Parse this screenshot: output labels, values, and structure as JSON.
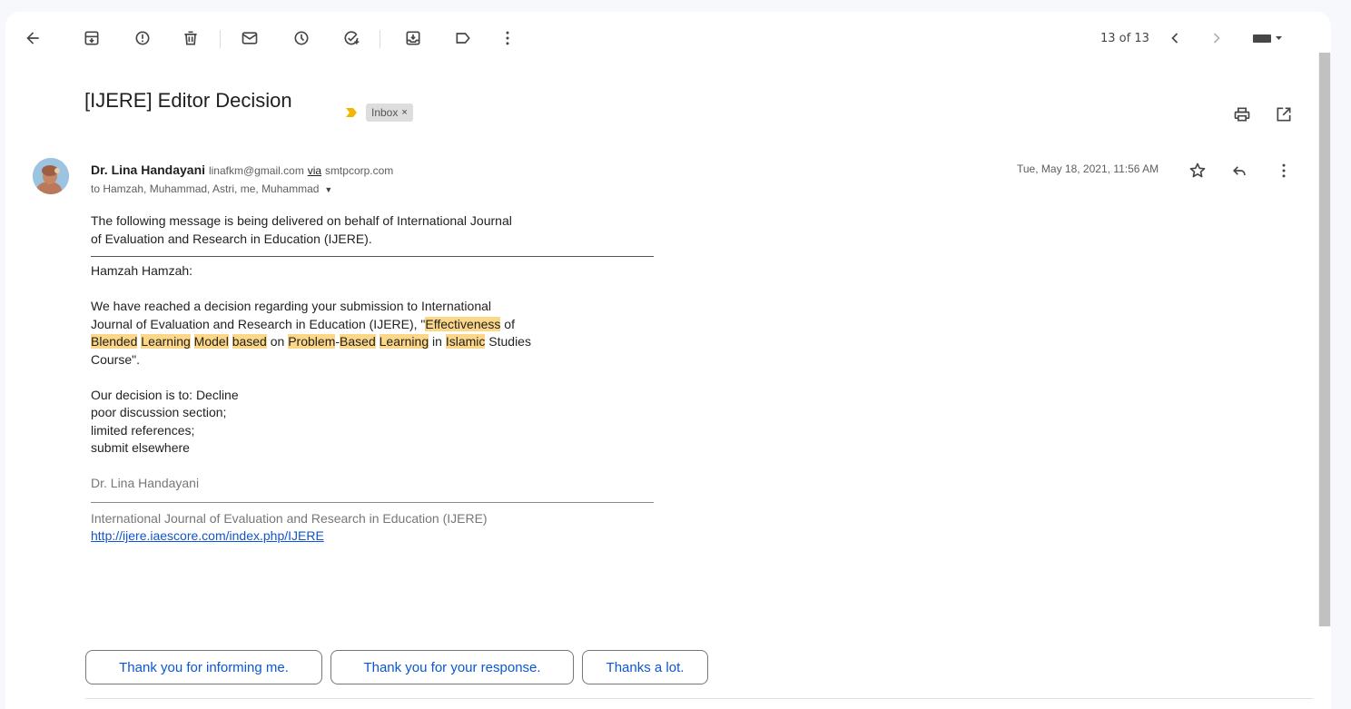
{
  "toolbar": {
    "icons": [
      "back-arrow-icon",
      "archive-icon",
      "report-spam-icon",
      "delete-icon",
      "mark-unread-icon",
      "snooze-icon",
      "add-to-tasks-icon",
      "move-to-icon",
      "label-icon",
      "more-vert-icon",
      "newer-icon",
      "older-icon",
      "input-tools-icon"
    ],
    "counter": "13 of 13"
  },
  "subject": {
    "title": "[IJERE] Editor Decision",
    "label": "Inbox",
    "label_remove": "×"
  },
  "message": {
    "sender_name": "Dr. Lina Handayani",
    "sender_email": "linafkm@gmail.com",
    "via_label": "via",
    "via_domain": "smtpcorp.com",
    "recipients": "to Hamzah, Muhammad, Astri, me, Muhammad",
    "date": "Tue, May 18, 2021, 11:56 AM"
  },
  "body": {
    "intro_1": "The following message is being delivered on behalf of International Journal",
    "intro_2": "of Evaluation and Research in Education (IJERE).",
    "greeting": "Hamzah Hamzah:",
    "p1_line1": "We have reached a decision regarding your submission to International",
    "p1_line2_pre": "Journal of Evaluation and Research in Education (IJERE), \"",
    "hl_effectiveness": "Effectiveness",
    "w_of": " of",
    "hl_blended": "Blended",
    "hl_learning1": "Learning",
    "hl_model": "Model",
    "hl_based": "based",
    "w_on": " on ",
    "hl_problem": "Problem",
    "w_dash": "-",
    "hl_based2": "Based",
    "hl_learning2": "Learning",
    "w_in": " in ",
    "hl_islamic": "Islamic",
    "w_studies": " Studies",
    "p1_end": "Course\".",
    "decision": "Our decision is to: Decline",
    "reason1": "poor discussion section;",
    "reason2": "limited references;",
    "reason3": "submit elsewhere",
    "signature": "Dr. Lina Handayani",
    "journal": "International Journal of Evaluation and Research in Education (IJERE)",
    "url": "http://ijere.iaescore.com/index.php/IJERE"
  },
  "smart_replies": [
    "Thank you for informing me.",
    "Thank you for your response.",
    "Thanks a lot."
  ],
  "colors": {
    "highlight": "#fcd787",
    "link": "#1155cc",
    "reply_text": "#0b57d0",
    "importance": "#f2b600"
  }
}
